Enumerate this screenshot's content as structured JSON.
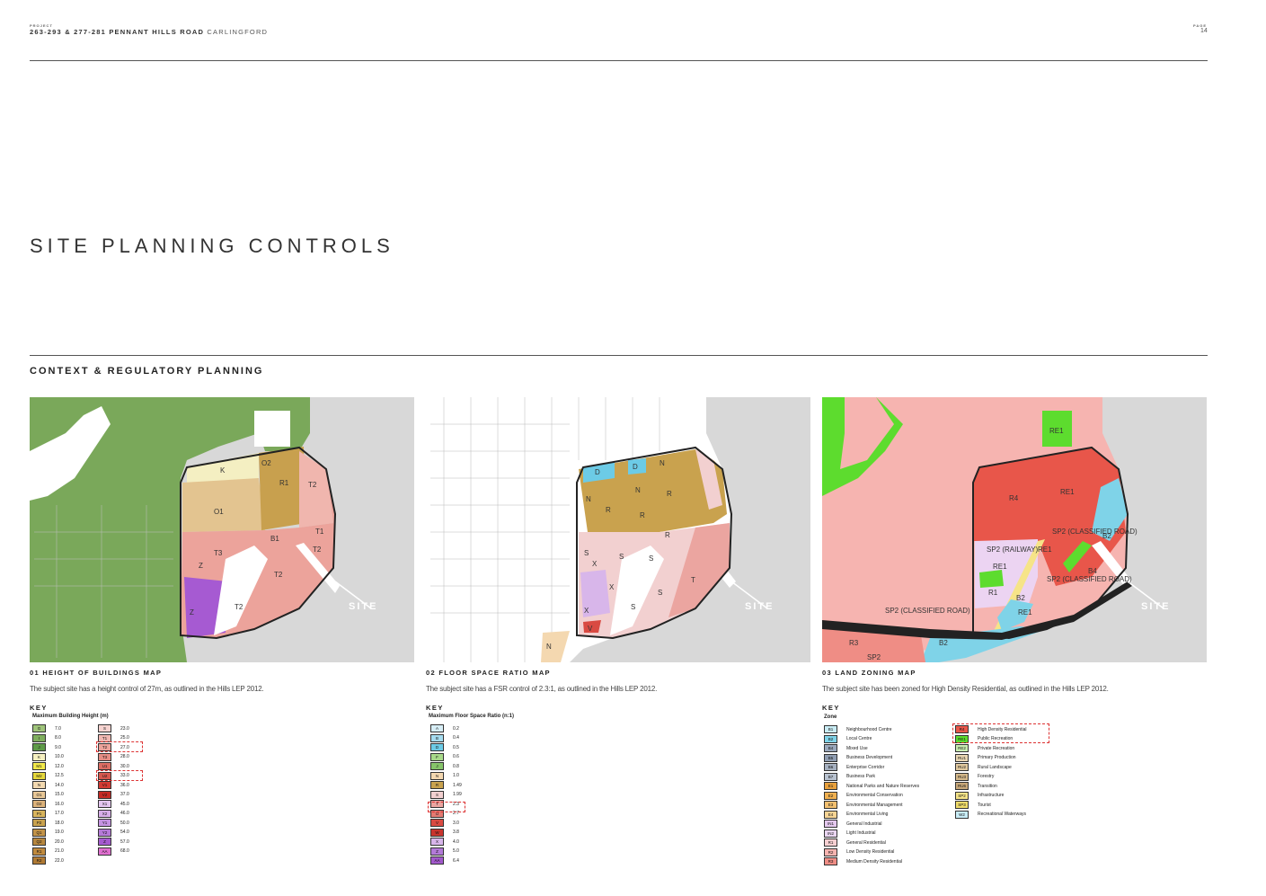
{
  "header": {
    "project_label": "PROJECT",
    "project_address": "263-293 & 277-281 PENNANT HILLS ROAD",
    "project_suburb": "CARLINGFORD",
    "page_label": "PAGE",
    "page_number": "14"
  },
  "page_title": "SITE PLANNING CONTROLS",
  "section_title": "CONTEXT & REGULATORY PLANNING",
  "site_label": "SITE",
  "key_label": "KEY",
  "maps": [
    {
      "title": "01 HEIGHT OF BUILDINGS MAP",
      "description": "The subject site has a height control of 27m, as outlined in the Hills LEP 2012.",
      "legend_title": "Maximum Building Height (m)",
      "zone_labels": [
        "K",
        "O2",
        "R1",
        "T2",
        "O1",
        "B1",
        "T3",
        "T1",
        "Z",
        "T2",
        "T2",
        "Z",
        "T2"
      ],
      "legend_col1": [
        {
          "code": "G",
          "value": "7.0",
          "color": "#9fc47a"
        },
        {
          "code": "I",
          "value": "8.0",
          "color": "#7fae5e"
        },
        {
          "code": "J",
          "value": "9.0",
          "color": "#5e9a48"
        },
        {
          "code": "K",
          "value": "10.0",
          "color": "#f6f0c0"
        },
        {
          "code": "M1",
          "value": "12.0",
          "color": "#f2e94a"
        },
        {
          "code": "M2",
          "value": "12.5",
          "color": "#e6d83c"
        },
        {
          "code": "N",
          "value": "14.0",
          "color": "#f3d9b0"
        },
        {
          "code": "O1",
          "value": "15.0",
          "color": "#e8c796"
        },
        {
          "code": "O2",
          "value": "16.0",
          "color": "#dcb27a"
        },
        {
          "code": "P1",
          "value": "17.0",
          "color": "#d8b45c"
        },
        {
          "code": "P2",
          "value": "18.0",
          "color": "#c9a24e"
        },
        {
          "code": "Q1",
          "value": "19.0",
          "color": "#c29348"
        },
        {
          "code": "Q2",
          "value": "20.0",
          "color": "#b7873e"
        },
        {
          "code": "R1",
          "value": "21.0",
          "color": "#c08a3e"
        },
        {
          "code": "R2",
          "value": "22.0",
          "color": "#b07a34"
        }
      ],
      "legend_col2": [
        {
          "code": "S",
          "value": "23.0",
          "color": "#f6d3d0"
        },
        {
          "code": "T1",
          "value": "25.0",
          "color": "#f1b8b2"
        },
        {
          "code": "T2",
          "value": "27.0",
          "color": "#eca39b"
        },
        {
          "code": "T3",
          "value": "28.0",
          "color": "#e48d84"
        },
        {
          "code": "U1",
          "value": "30.0",
          "color": "#dd6e64"
        },
        {
          "code": "U2",
          "value": "33.0",
          "color": "#d6584e"
        },
        {
          "code": "V1",
          "value": "36.0",
          "color": "#d33a33"
        },
        {
          "code": "V2",
          "value": "37.0",
          "color": "#c52a24"
        },
        {
          "code": "X1",
          "value": "45.0",
          "color": "#e4c6f0"
        },
        {
          "code": "X2",
          "value": "46.0",
          "color": "#d7aee9"
        },
        {
          "code": "Y1",
          "value": "50.0",
          "color": "#c593e2"
        },
        {
          "code": "Y2",
          "value": "54.0",
          "color": "#b57ad8"
        },
        {
          "code": "Z",
          "value": "57.0",
          "color": "#a55ad0"
        },
        {
          "code": "AA",
          "value": "68.0",
          "color": "#e06fd0"
        }
      ]
    },
    {
      "title": "02 FLOOR SPACE RATIO MAP",
      "description": "The subject site has a FSR control of 2.3:1, as outlined in the Hills LEP 2012.",
      "legend_title": "Maximum Floor Space Ratio (n:1)",
      "zone_labels": [
        "D",
        "D",
        "N",
        "N",
        "N",
        "R",
        "R",
        "R",
        "R",
        "S",
        "S",
        "S",
        "S",
        "X",
        "X",
        "S",
        "X",
        "V",
        "N",
        "T"
      ],
      "legend_col1": [
        {
          "code": "A",
          "value": "0.2",
          "color": "#d7eef6"
        },
        {
          "code": "B",
          "value": "0.4",
          "color": "#a6dcef"
        },
        {
          "code": "D",
          "value": "0.5",
          "color": "#6ccbe6"
        },
        {
          "code": "F",
          "value": "0.6",
          "color": "#a8d98a"
        },
        {
          "code": "J",
          "value": "0.8",
          "color": "#86c46a"
        },
        {
          "code": "N",
          "value": "1.0",
          "color": "#f4d8b0"
        },
        {
          "code": "R",
          "value": "1.49",
          "color": "#c9a24e"
        },
        {
          "code": "S",
          "value": "1.99",
          "color": "#f2d0d0"
        },
        {
          "code": "T",
          "value": "2.3",
          "color": "#eba5a0"
        },
        {
          "code": "U",
          "value": "2.7",
          "color": "#e47a72"
        },
        {
          "code": "V",
          "value": "3.0",
          "color": "#d94a42"
        },
        {
          "code": "W",
          "value": "3.8",
          "color": "#c8342e"
        },
        {
          "code": "X",
          "value": "4.0",
          "color": "#d8b6ea"
        },
        {
          "code": "Z",
          "value": "5.0",
          "color": "#b37ad8"
        },
        {
          "code": "AA",
          "value": "6.4",
          "color": "#a259cc"
        }
      ]
    },
    {
      "title": "03 LAND ZONING MAP",
      "description": "The subject site has been zoned for High Density Residential, as outlined in the Hills LEP 2012.",
      "legend_title": "Zone",
      "zone_labels": [
        "RE1",
        "R4",
        "RE1",
        "SP2 (CLASSIFIED ROAD)",
        "B2",
        "SP2 (RAILWAY)",
        "RE1",
        "RE1",
        "B4",
        "SP2 (CLASSIFIED ROAD)",
        "R1",
        "B2",
        "RE1",
        "SP2 (CLASSIFIED ROAD)",
        "R3",
        "B2",
        "SP2"
      ],
      "legend_col1": [
        {
          "code": "B1",
          "value": "Neighbourhood Centre",
          "color": "#c9ecf4"
        },
        {
          "code": "B2",
          "value": "Local Centre",
          "color": "#7fd3e8"
        },
        {
          "code": "B4",
          "value": "Mixed Use",
          "color": "#9aa8bc"
        },
        {
          "code": "B5",
          "value": "Business Development",
          "color": "#8f9db2"
        },
        {
          "code": "B6",
          "value": "Enterprise Corridor",
          "color": "#a5b0c0"
        },
        {
          "code": "B7",
          "value": "Business Park",
          "color": "#b8c2d0"
        },
        {
          "code": "E1",
          "value": "National Parks and Nature Reserves",
          "color": "#e8a03c"
        },
        {
          "code": "E2",
          "value": "Environmental Conservation",
          "color": "#f0b050"
        },
        {
          "code": "E3",
          "value": "Environmental Management",
          "color": "#f3c070"
        },
        {
          "code": "E4",
          "value": "Environmental Living",
          "color": "#f6d494"
        },
        {
          "code": "IN1",
          "value": "General Industrial",
          "color": "#e4c8ee"
        },
        {
          "code": "IN2",
          "value": "Light Industrial",
          "color": "#ead6f2"
        },
        {
          "code": "R1",
          "value": "General Residential",
          "color": "#f6d0d2"
        },
        {
          "code": "R2",
          "value": "Low Density Residential",
          "color": "#f6b4b0"
        },
        {
          "code": "R3",
          "value": "Medium Density Residential",
          "color": "#ef8d85"
        }
      ],
      "legend_col2": [
        {
          "code": "R4",
          "value": "High Density Residential",
          "color": "#e8564a"
        },
        {
          "code": "RE1",
          "value": "Public Recreation",
          "color": "#5ddc2e"
        },
        {
          "code": "RE2",
          "value": "Private Recreation",
          "color": "#c8ecb0"
        },
        {
          "code": "RU1",
          "value": "Primary Production",
          "color": "#e9d6b2"
        },
        {
          "code": "RU2",
          "value": "Rural Landscape",
          "color": "#e0c89e"
        },
        {
          "code": "RU3",
          "value": "Forestry",
          "color": "#d4b88a"
        },
        {
          "code": "RU6",
          "value": "Transition",
          "color": "#c8a87a"
        },
        {
          "code": "SP2",
          "value": "Infrastructure",
          "color": "#f6e488"
        },
        {
          "code": "SP3",
          "value": "Tourist",
          "color": "#f0dc6a"
        },
        {
          "code": "W2",
          "value": "Recreational Waterways",
          "color": "#c8ecf6"
        }
      ]
    }
  ]
}
